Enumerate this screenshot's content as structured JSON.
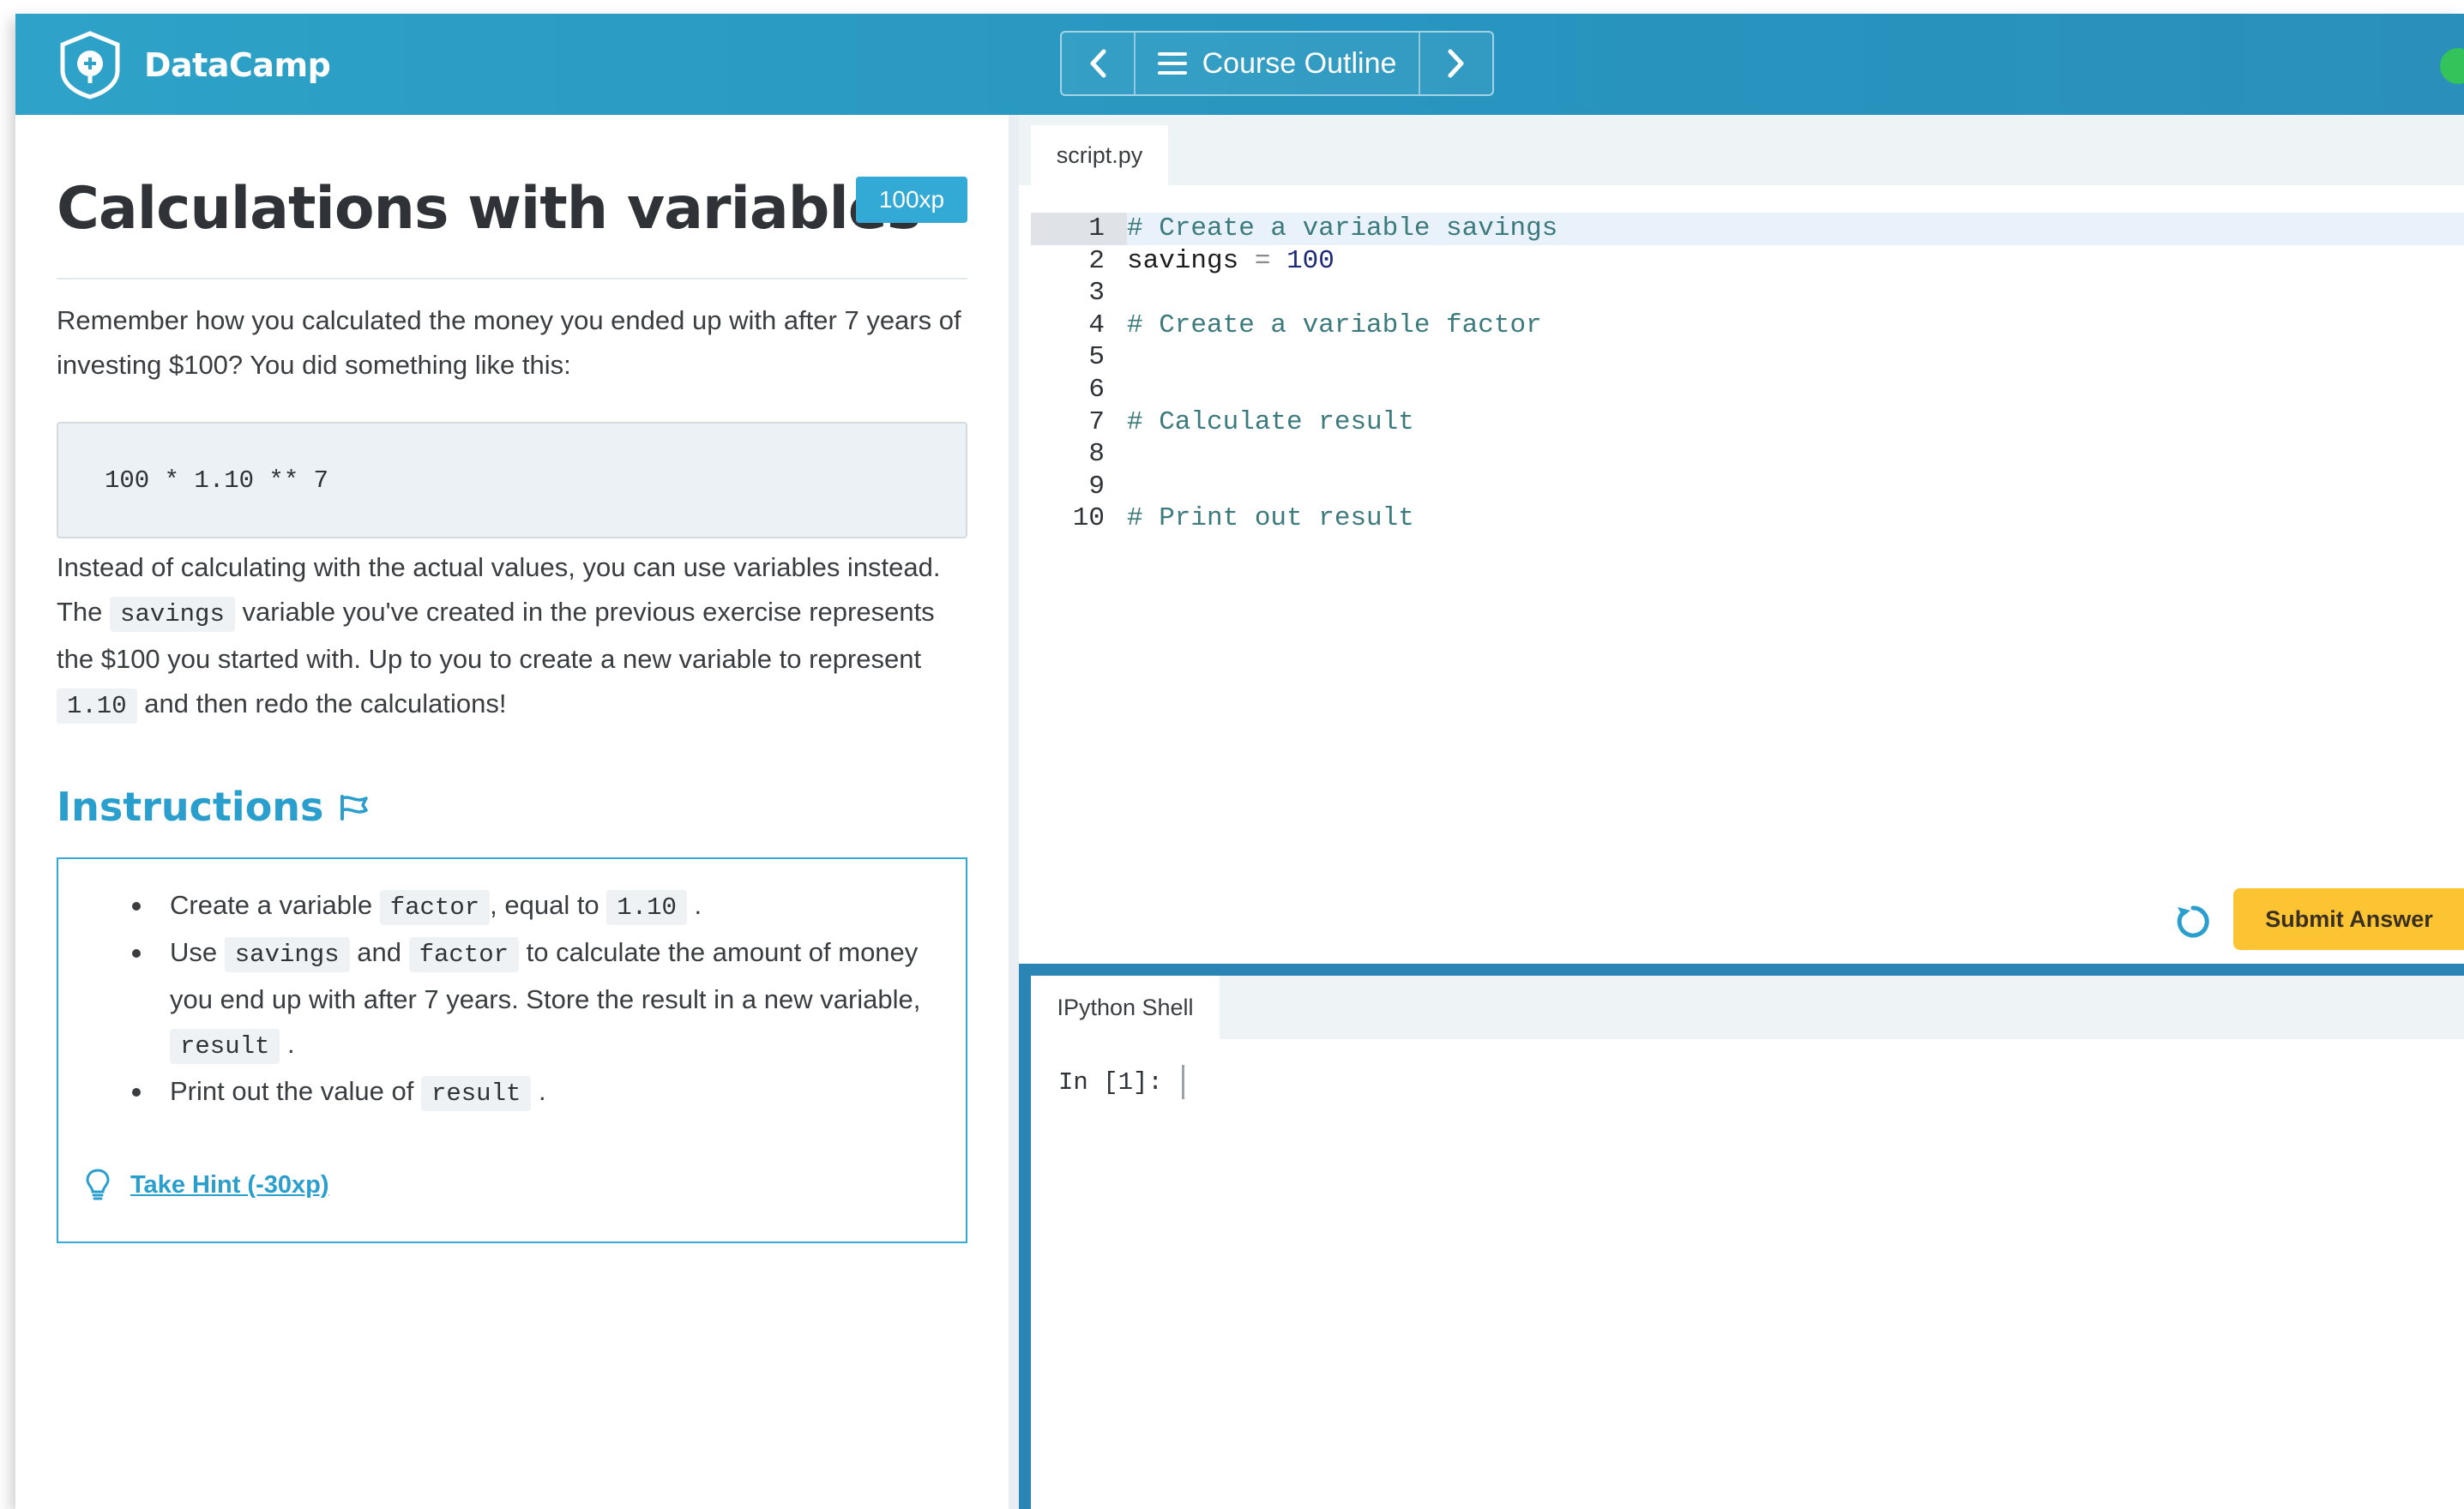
{
  "header": {
    "brand": "DataCamp",
    "nav": {
      "prev_icon": "chevron-left-icon",
      "next_icon": "chevron-right-icon",
      "course_outline_label": "Course Outline"
    },
    "status_color": "#33c35a"
  },
  "exercise": {
    "title": "Calculations with variables",
    "xp": "100xp",
    "intro_text": "Remember how you calculated the money you ended up with after 7 years of investing $100? You did something like this:",
    "code_example": "100 * 1.10 ** 7",
    "para2": {
      "t1": "Instead of calculating with the actual values, you can use variables instead. The",
      "c1": "savings",
      "t2": "variable you've created in the previous exercise represents the $100 you started with. Up to you to create a new variable to represent",
      "c2": "1.10",
      "t3": "and then redo the calculations!"
    }
  },
  "instructions": {
    "heading": "Instructions",
    "item1": {
      "t1": "Create a variable",
      "c1": "factor",
      "t2": ", equal to",
      "c2": "1.10",
      "t3": "."
    },
    "item2": {
      "t1": "Use",
      "c1": "savings",
      "t2": "and",
      "c2": "factor",
      "t3": "to calculate the amount of money you end up with after 7 years. Store the result in a new variable,",
      "c3": "result",
      "t4": "."
    },
    "item3": {
      "t1": "Print out the value of",
      "c1": "result",
      "t2": "."
    },
    "hint_label": "Take Hint (-30xp)"
  },
  "editor": {
    "tab_name": "script.py",
    "line_numbers": [
      "1",
      "2",
      "3",
      "4",
      "5",
      "6",
      "7",
      "8",
      "9",
      "10"
    ],
    "lines": {
      "l1": "# Create a variable savings",
      "l2_name": "savings",
      "l2_op": "=",
      "l2_value": "100",
      "l4": "# Create a variable factor",
      "l7": "# Calculate result",
      "l10": "# Print out result"
    },
    "submit_label": "Submit Answer",
    "accent_submit": "#fcc433"
  },
  "shell": {
    "tab_name": "IPython Shell",
    "prompt": "In [1]:"
  }
}
